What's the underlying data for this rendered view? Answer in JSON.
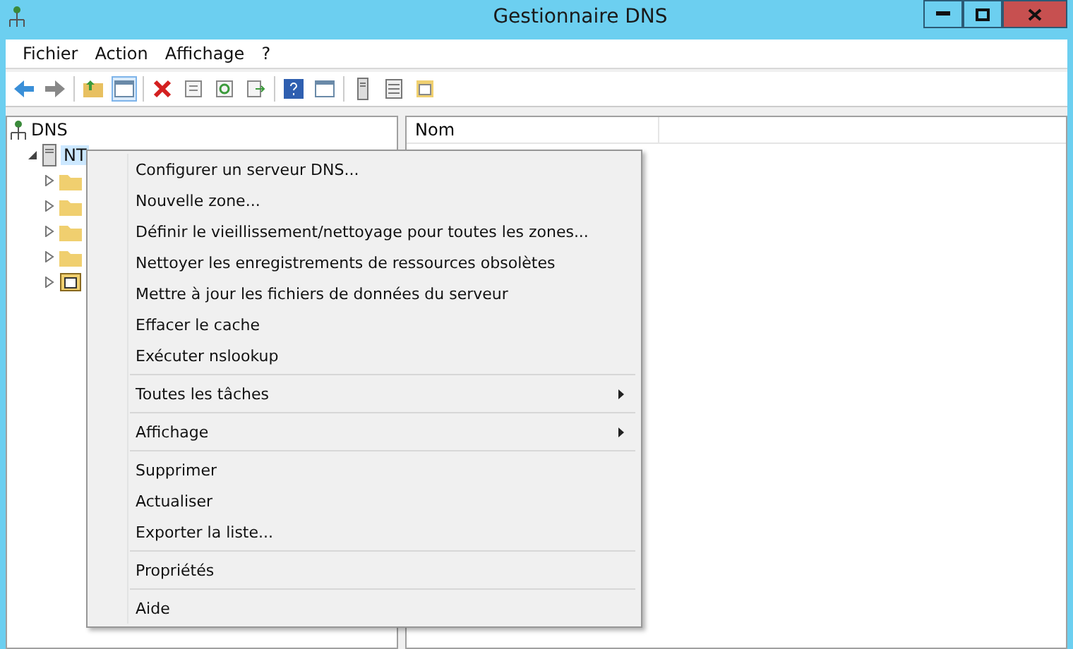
{
  "window": {
    "title": "Gestionnaire DNS"
  },
  "menu_bar": [
    "Fichier",
    "Action",
    "Affichage",
    "?"
  ],
  "tree": {
    "label": "DNS",
    "children": [
      {
        "label": "NT",
        "expanded": true,
        "children": [
          {
            "kind": "folder",
            "expanded": false
          },
          {
            "kind": "folder",
            "expanded": false
          },
          {
            "kind": "folder",
            "expanded": false
          },
          {
            "kind": "folder",
            "expanded": false
          },
          {
            "kind": "log",
            "expanded": false
          }
        ]
      }
    ]
  },
  "list": {
    "columns": [
      "Nom"
    ]
  },
  "context_menu": [
    {
      "kind": "item",
      "label": "Configurer un serveur DNS..."
    },
    {
      "kind": "item",
      "label": "Nouvelle zone..."
    },
    {
      "kind": "item",
      "label": "Définir le vieillissement/nettoyage pour toutes les zones..."
    },
    {
      "kind": "item",
      "label": "Nettoyer les enregistrements de ressources obsolètes"
    },
    {
      "kind": "item",
      "label": "Mettre à jour les fichiers de données du serveur"
    },
    {
      "kind": "item",
      "label": "Effacer le cache"
    },
    {
      "kind": "item",
      "label": "Exécuter nslookup"
    },
    {
      "kind": "separator"
    },
    {
      "kind": "submenu",
      "label": "Toutes les tâches"
    },
    {
      "kind": "separator"
    },
    {
      "kind": "submenu",
      "label": "Affichage"
    },
    {
      "kind": "separator"
    },
    {
      "kind": "item",
      "label": "Supprimer"
    },
    {
      "kind": "item",
      "label": "Actualiser"
    },
    {
      "kind": "item",
      "label": "Exporter la liste..."
    },
    {
      "kind": "separator"
    },
    {
      "kind": "item",
      "label": "Propriétés"
    },
    {
      "kind": "separator"
    },
    {
      "kind": "item",
      "label": "Aide"
    }
  ]
}
